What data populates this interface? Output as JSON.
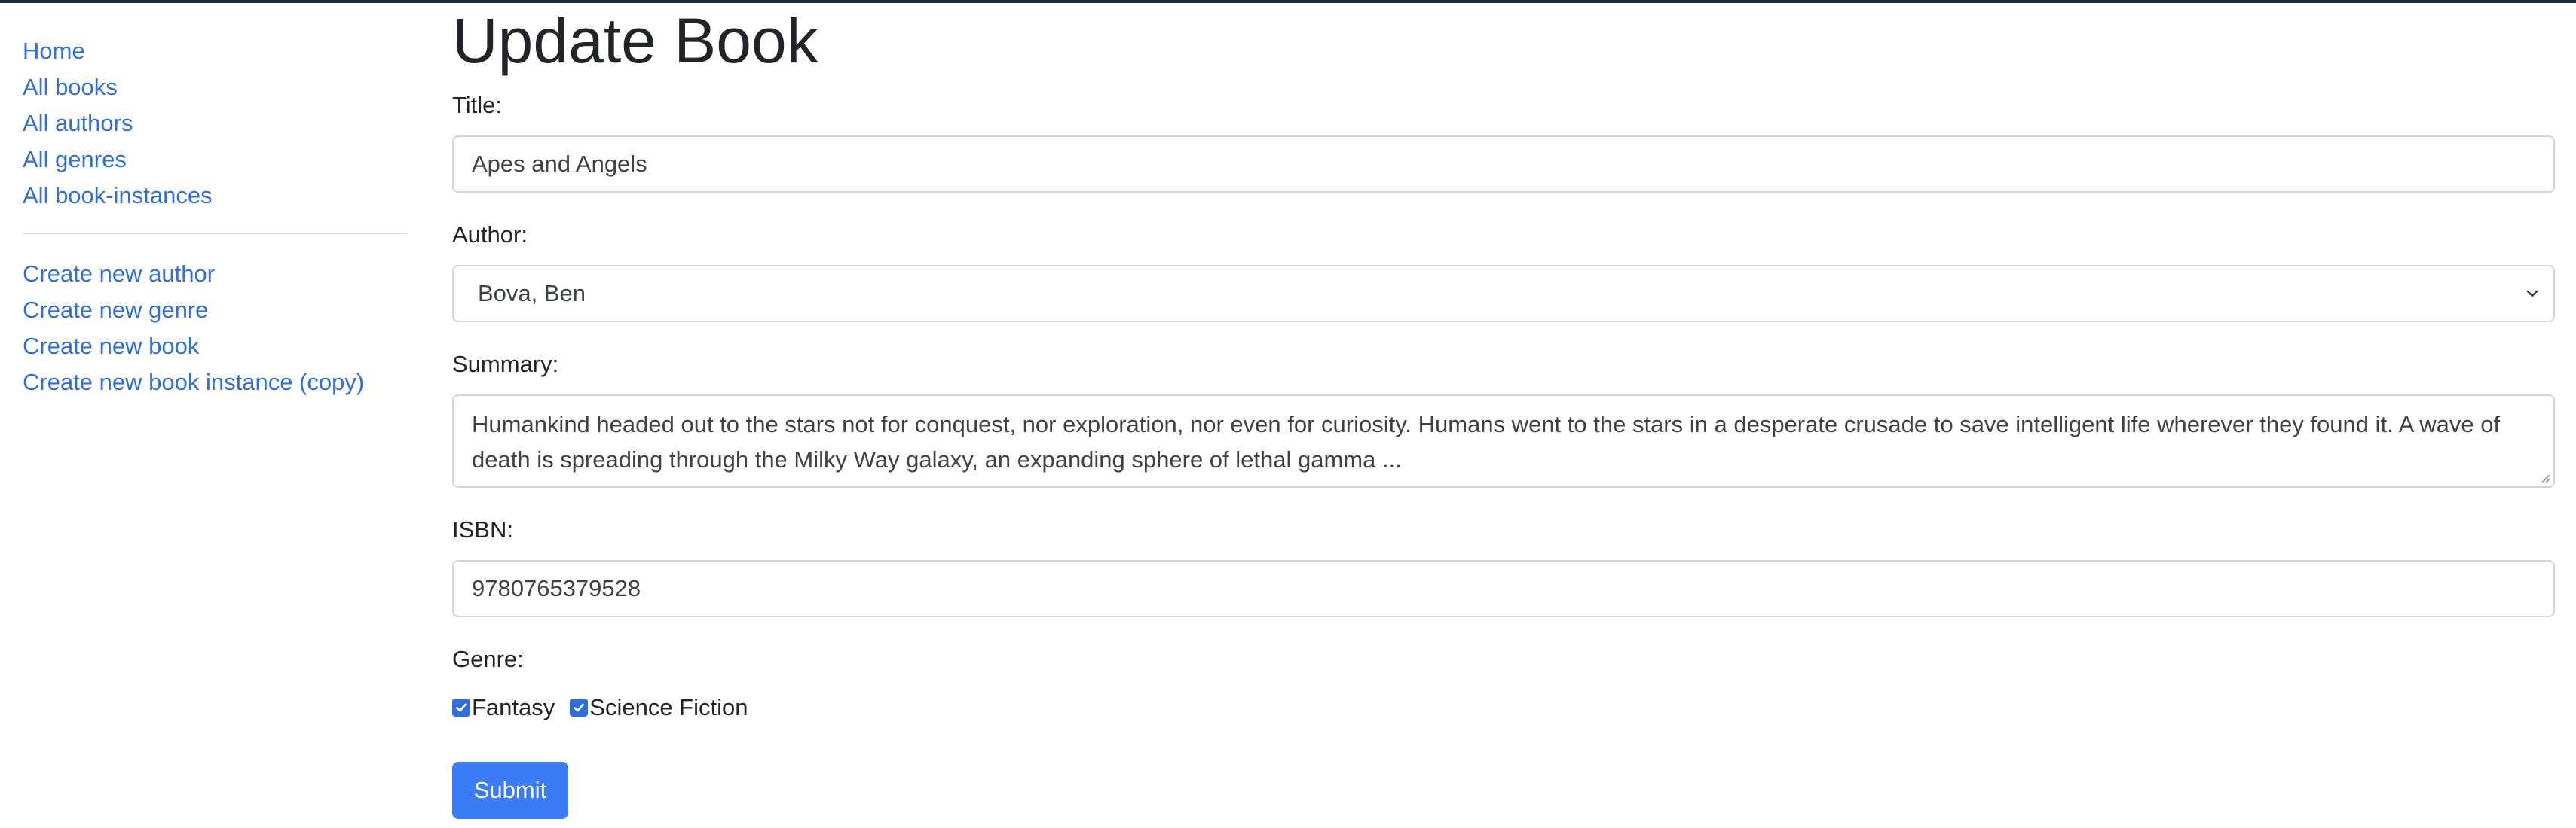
{
  "page": {
    "title": "Update Book"
  },
  "sidebar": {
    "nav_links": [
      {
        "label": "Home"
      },
      {
        "label": "All books"
      },
      {
        "label": "All authors"
      },
      {
        "label": "All genres"
      },
      {
        "label": "All book-instances"
      }
    ],
    "create_links": [
      {
        "label": "Create new author"
      },
      {
        "label": "Create new genre"
      },
      {
        "label": "Create new book"
      },
      {
        "label": "Create new book instance (copy)"
      }
    ]
  },
  "form": {
    "title": {
      "label": "Title:",
      "value": "Apes and Angels"
    },
    "author": {
      "label": "Author:",
      "selected": "Bova, Ben"
    },
    "summary": {
      "label": "Summary:",
      "value": "Humankind headed out to the stars not for conquest, nor exploration, nor even for curiosity. Humans went to the stars in a desperate crusade to save intelligent life wherever they found it. A wave of death is spreading through the Milky Way galaxy, an expanding sphere of lethal gamma ..."
    },
    "isbn": {
      "label": "ISBN:",
      "value": "9780765379528"
    },
    "genre": {
      "label": "Genre:",
      "options": [
        {
          "label": "Fantasy",
          "checked": true
        },
        {
          "label": "Science Fiction",
          "checked": true
        }
      ]
    },
    "submit_label": "Submit"
  },
  "colors": {
    "link": "#2f6fdd",
    "primary_button": "#3b7cf5",
    "top_bar": "#1c2a38",
    "border": "#ced4da"
  }
}
